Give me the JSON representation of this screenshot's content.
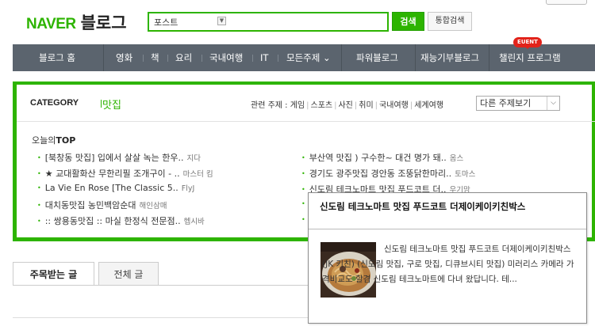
{
  "header": {
    "logo_naver": "NAVER",
    "logo_blog": "블로그",
    "search": {
      "scope": "포스트",
      "value": "",
      "search_button": "검색",
      "total_search_button": "통합검색"
    }
  },
  "nav": {
    "items": [
      {
        "label": "블로그 홈"
      },
      {
        "label": "영화"
      },
      {
        "label": "책"
      },
      {
        "label": "요리"
      },
      {
        "label": "국내여행"
      },
      {
        "label": "IT"
      },
      {
        "label": "모든주제 ⌄"
      },
      {
        "label": "파워블로그"
      },
      {
        "label": "재능기부블로그"
      },
      {
        "label": "챌린지 프로그램"
      }
    ],
    "event_badge": "EUENT"
  },
  "category": {
    "title": "CATEGORY",
    "current": "맛집",
    "related_label": "관련 주제 :",
    "related_topics": [
      "게임",
      "스포츠",
      "사진",
      "취미",
      "국내여행",
      "세계여행"
    ],
    "topic_select": "다른 주제보기",
    "today_prefix": "오늘의",
    "today_top": "TOP"
  },
  "posts": {
    "left": [
      {
        "title": "[북창동 맛집] 입에서 살살 녹는 한우..",
        "author": "지다"
      },
      {
        "title": "★ 교대활화산 무한리필 조개구이 - ..",
        "author": "마스터 킴"
      },
      {
        "title": "La Vie En Rose [The Classic 5..",
        "author": "FlyJ"
      },
      {
        "title": "대치동맛집 농민백암순대",
        "author": "해인삼매"
      },
      {
        "title": ":: 쌍용동맛집 :: 마실 한정식 전문점..",
        "author": "헵시바"
      }
    ],
    "right": [
      {
        "title": "부산역 맛집 ) 구수한~ 대건 명가 돼..",
        "author": "옴스"
      },
      {
        "title": "경기도 광주맛집 경안동 조뚱닭한마리..",
        "author": "토마스"
      },
      {
        "title": "신도림 테크노마트 맛집 푸드코트 더..",
        "author": "우기맘"
      }
    ]
  },
  "tabs": {
    "featured": "주목받는 글",
    "all": "전체 글"
  },
  "popup": {
    "title": "신도림 테크노마트 맛집 푸드코트 더제이케이키친박스",
    "description": "신도림 테크노마트 맛집 푸드코트 더제이케이키친박스(JK 키친) (신도림 맛집, 구로 맛집, 디큐브시티 맛집) 미러리스 카메라 가격비교도 할겸 신도림 테크노마트에 다녀 왔답니다. 테...",
    "thumbnail_alt": "noodle-dish-photo"
  },
  "colors": {
    "brand_green": "#2db400",
    "nav_bg": "#5b646e",
    "event_red": "#e2231a"
  }
}
